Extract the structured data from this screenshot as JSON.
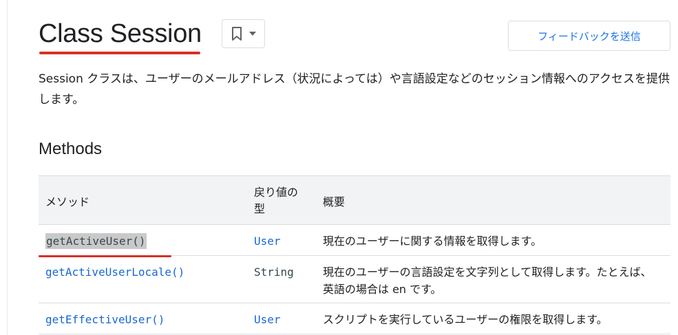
{
  "page": {
    "title": "Class Session",
    "description": "Session クラスは、ユーザーのメールアドレス（状況によっては）や言語設定などのセッション情報へのアクセスを提供します。"
  },
  "toolbar": {
    "bookmark_icon": "bookmark-icon",
    "dropdown_icon": "caret-down-icon",
    "feedback_label": "フィードバックを送信"
  },
  "methods": {
    "heading": "Methods",
    "columns": {
      "method": "メソッド",
      "return_type_line1": "戻り値の",
      "return_type_line2": "型",
      "summary": "概要"
    },
    "rows": [
      {
        "method": "getActiveUser()",
        "return_type": "User",
        "summary": "現在のユーザーに関する情報を取得します。"
      },
      {
        "method": "getActiveUserLocale()",
        "return_type": "String",
        "summary": "現在のユーザーの言語設定を文字列として取得します。たとえば、英語の場合は en です。"
      },
      {
        "method": "getEffectiveUser()",
        "return_type": "User",
        "summary": "スクリプトを実行しているユーザーの権限を取得します。"
      }
    ]
  },
  "colors": {
    "link": "#1967d2",
    "annotation_red": "#d93025",
    "header_bg": "#f1f3f4"
  }
}
